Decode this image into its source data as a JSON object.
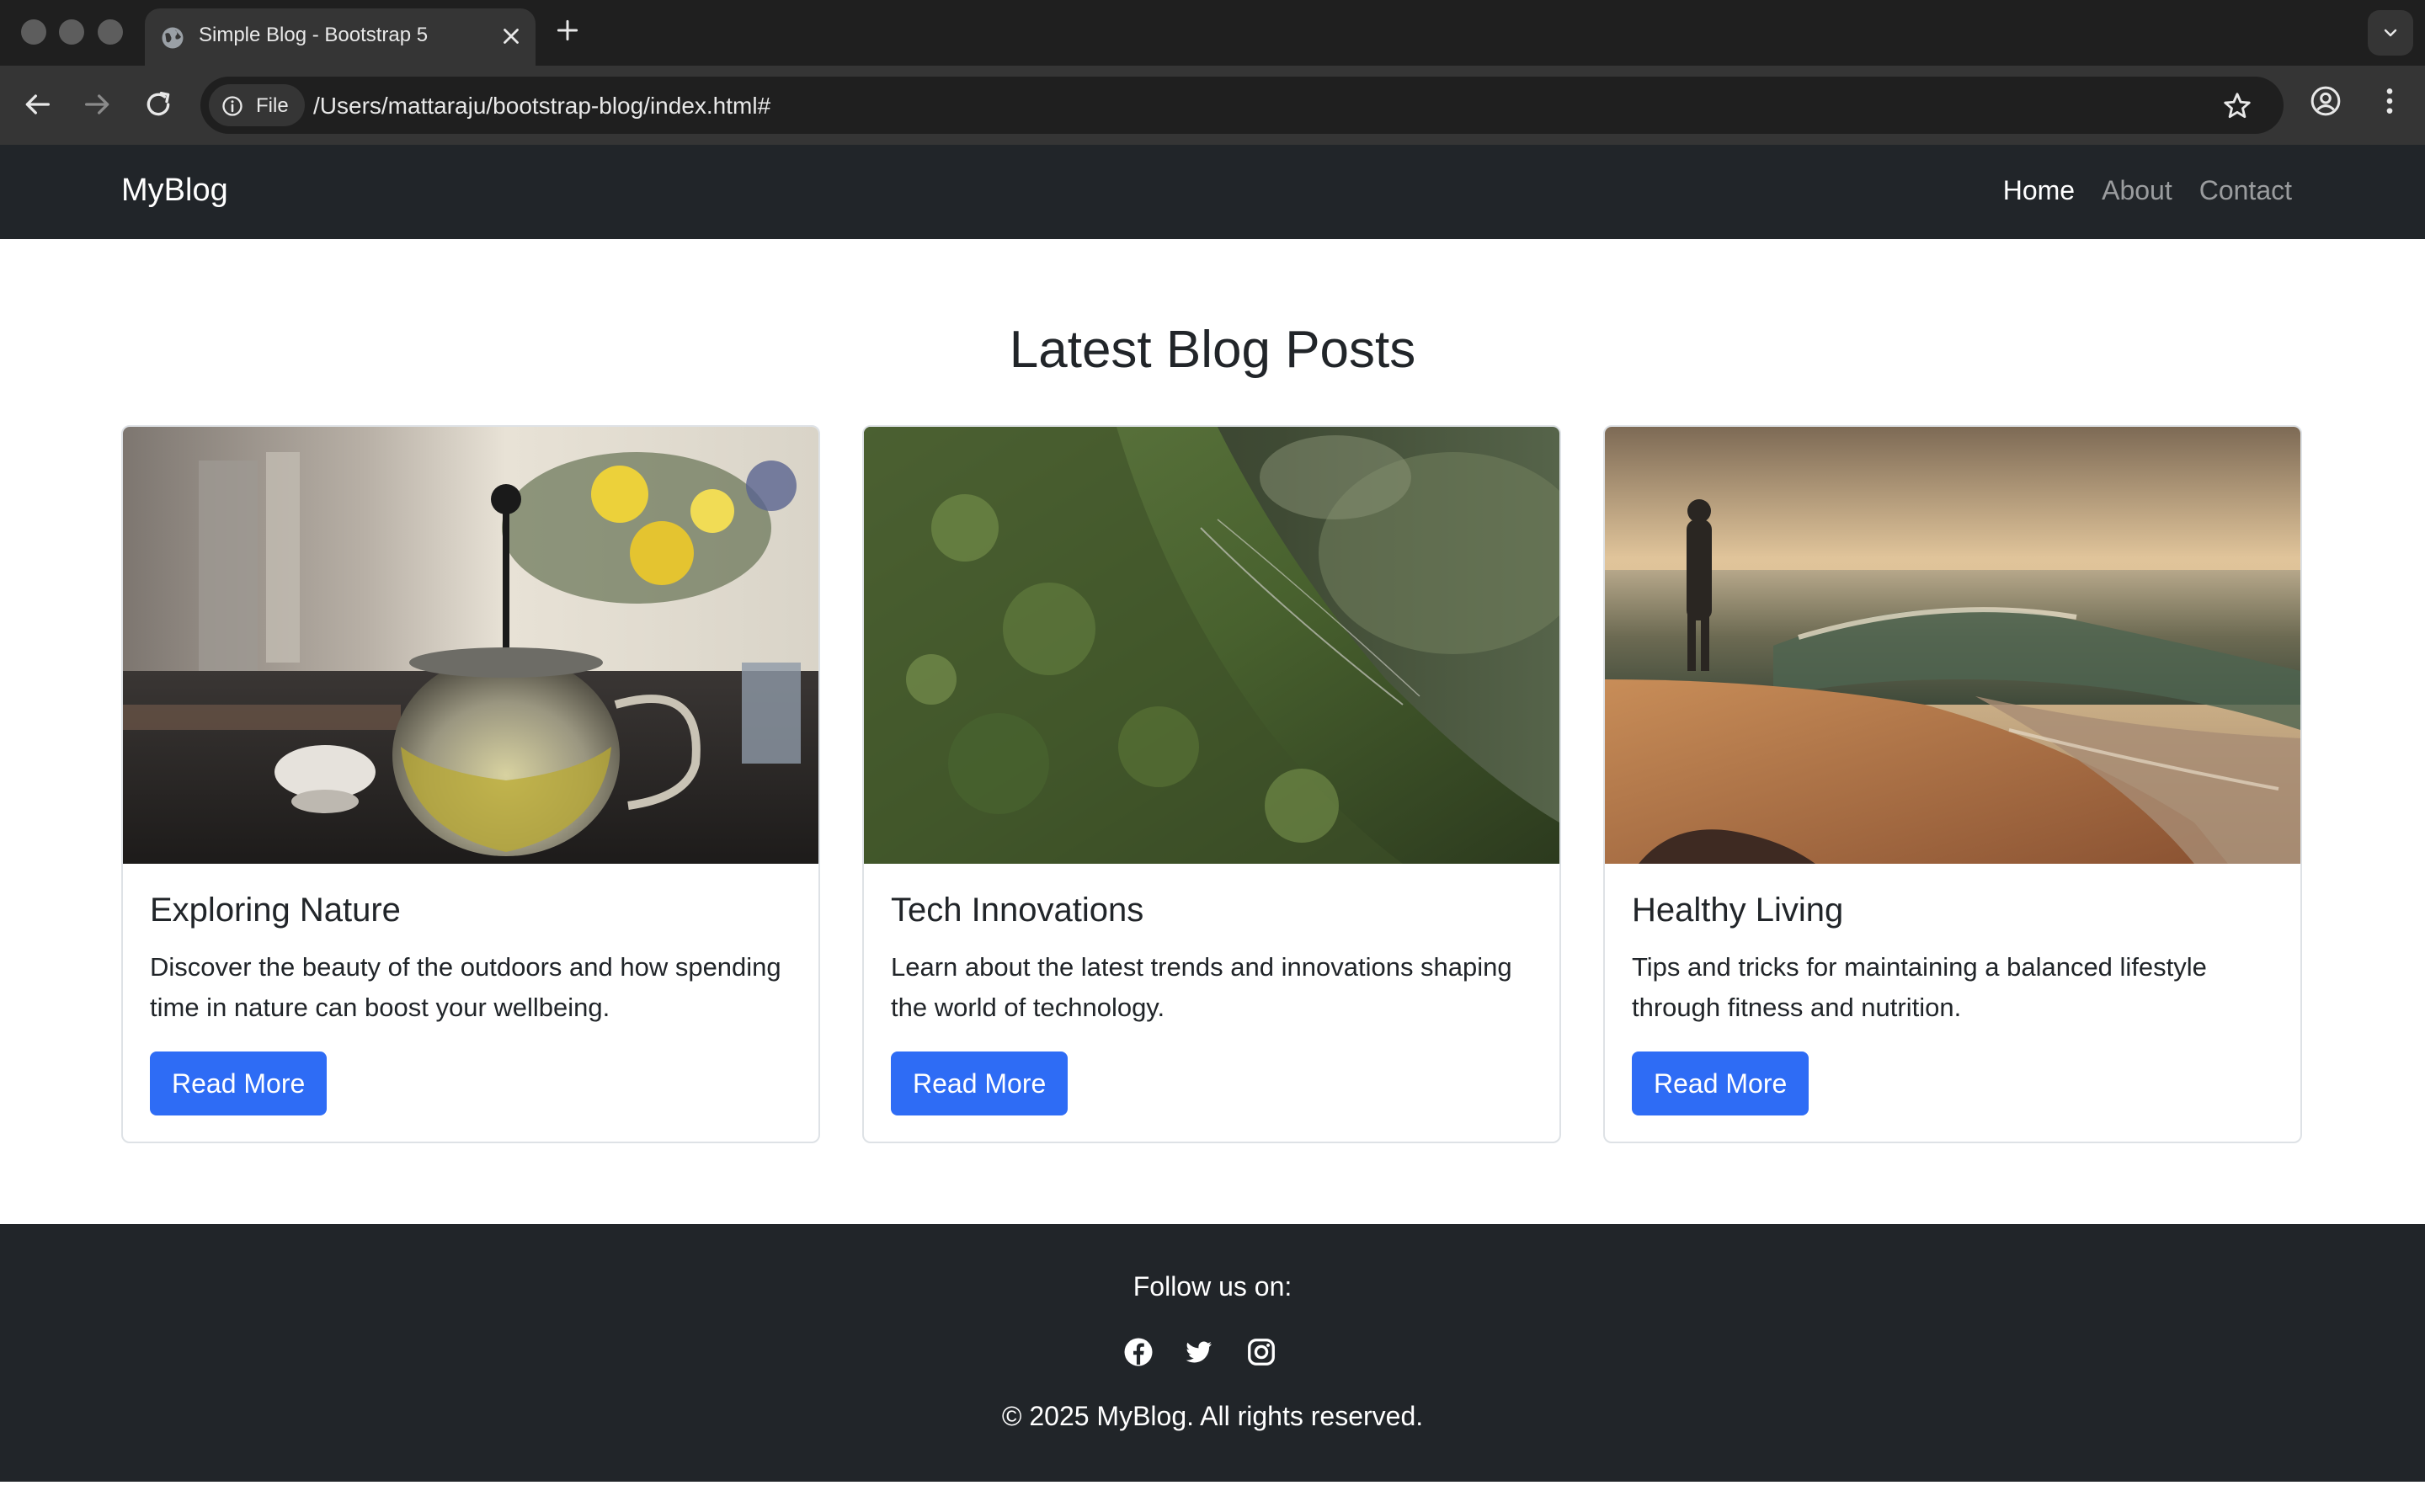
{
  "browser": {
    "tab_title": "Simple Blog - Bootstrap 5",
    "address_chip": "File",
    "url": "/Users/mattaraju/bootstrap-blog/index.html#"
  },
  "navbar": {
    "brand": "MyBlog",
    "links": [
      {
        "label": "Home",
        "active": true
      },
      {
        "label": "About",
        "active": false
      },
      {
        "label": "Contact",
        "active": false
      }
    ]
  },
  "main": {
    "heading": "Latest Blog Posts",
    "posts": [
      {
        "title": "Exploring Nature",
        "text": "Discover the beauty of the outdoors and how spending time in nature can boost your wellbeing.",
        "button": "Read More",
        "image": "teapot-photo"
      },
      {
        "title": "Tech Innovations",
        "text": "Learn about the latest trends and innovations shaping the world of technology.",
        "button": "Read More",
        "image": "moss-tree-photo"
      },
      {
        "title": "Healthy Living",
        "text": "Tips and tricks for maintaining a balanced lifestyle through fitness and nutrition.",
        "button": "Read More",
        "image": "beach-sunset-photo"
      }
    ]
  },
  "footer": {
    "follow": "Follow us on:",
    "socials": [
      "facebook-icon",
      "twitter-icon",
      "instagram-icon"
    ],
    "copyright": "© 2025 MyBlog. All rights reserved."
  },
  "colors": {
    "navbar_bg": "#212529",
    "primary": "#2e6cf5",
    "chrome_dark": "#1f1f1f",
    "chrome_toolbar": "#353535"
  }
}
